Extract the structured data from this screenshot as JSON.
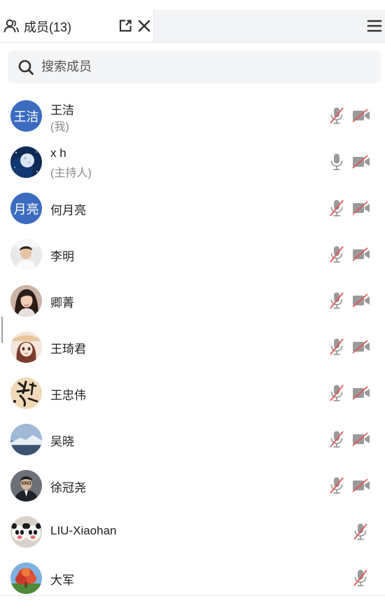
{
  "tab": {
    "label": "成员(13)",
    "icon": "user-icon"
  },
  "search": {
    "placeholder": "搜索成员",
    "value": ""
  },
  "colors": {
    "avatar_blue": "#3c6cc0",
    "muted_red": "#e25656",
    "icon_gray": "#9a9a9a"
  },
  "members": [
    {
      "name": "王洁",
      "role": "(我)",
      "avatar_text": "王洁",
      "avatar": "text",
      "mic": "muted",
      "camera": "off"
    },
    {
      "name": "x h",
      "role": "(主持人)",
      "avatar": "moon",
      "mic": "on",
      "camera": "off"
    },
    {
      "name": "何月亮",
      "avatar_text": "月亮",
      "avatar": "text",
      "mic": "muted",
      "camera": "off"
    },
    {
      "name": "李明",
      "avatar": "photo-boy",
      "mic": "muted",
      "camera": "off"
    },
    {
      "name": "卿菁",
      "avatar": "photo-girl",
      "mic": "muted",
      "camera": "off"
    },
    {
      "name": "王琦君",
      "avatar": "cartoon-girl",
      "mic": "muted",
      "camera": "off"
    },
    {
      "name": "王忠伟",
      "avatar": "calligraphy",
      "mic": "muted",
      "camera": "off"
    },
    {
      "name": "吴晓",
      "avatar": "mountain",
      "mic": "muted",
      "camera": "off"
    },
    {
      "name": "徐冠尧",
      "avatar": "photo-man",
      "mic": "muted",
      "camera": "off"
    },
    {
      "name": "LIU-Xiaohan",
      "avatar": "pandas",
      "mic": "muted",
      "camera": "none"
    },
    {
      "name": "大军",
      "avatar": "tree",
      "mic": "muted",
      "camera": "none"
    }
  ]
}
